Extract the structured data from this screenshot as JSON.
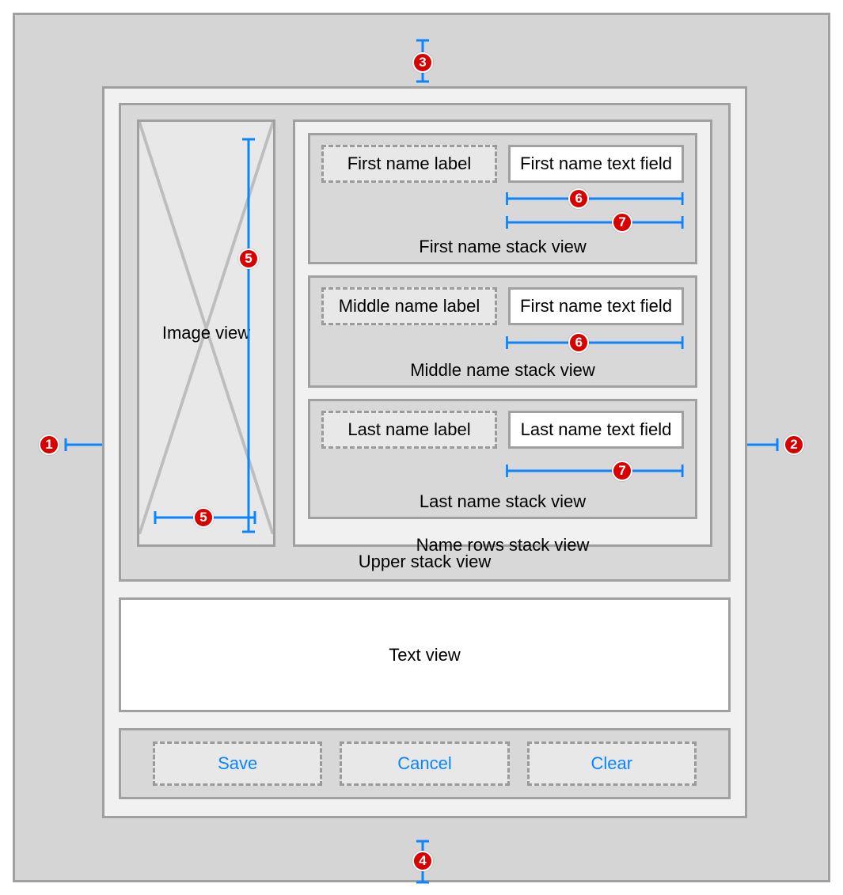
{
  "colors": {
    "accent_blue": "#0a84ff",
    "badge_red": "#d90000",
    "panel_gray": "#d5d5d5",
    "panel_light": "#f1f1f1",
    "panel_mid": "#d8d8d8",
    "border_gray": "#a0a0a0"
  },
  "badges": {
    "left": "1",
    "right": "2",
    "top": "3",
    "bottom": "4",
    "image_aspect_v": "5",
    "image_aspect_h": "5",
    "field_eq1a": "6",
    "field_eq1b": "7",
    "field_eq2": "6",
    "field_eq3": "7"
  },
  "image_view": {
    "label": "Image view"
  },
  "name_rows": {
    "caption": "Name rows stack view",
    "rows": [
      {
        "label": "First name label",
        "field": "First name text field",
        "caption": "First name stack view"
      },
      {
        "label": "Middle name label",
        "field": "First name text field",
        "caption": "Middle name stack view"
      },
      {
        "label": "Last name label",
        "field": "Last name text field",
        "caption": "Last name stack view"
      }
    ]
  },
  "upper_caption": "Upper stack view",
  "text_view": {
    "label": "Text view"
  },
  "buttons": {
    "save": "Save",
    "cancel": "Cancel",
    "clear": "Clear"
  }
}
